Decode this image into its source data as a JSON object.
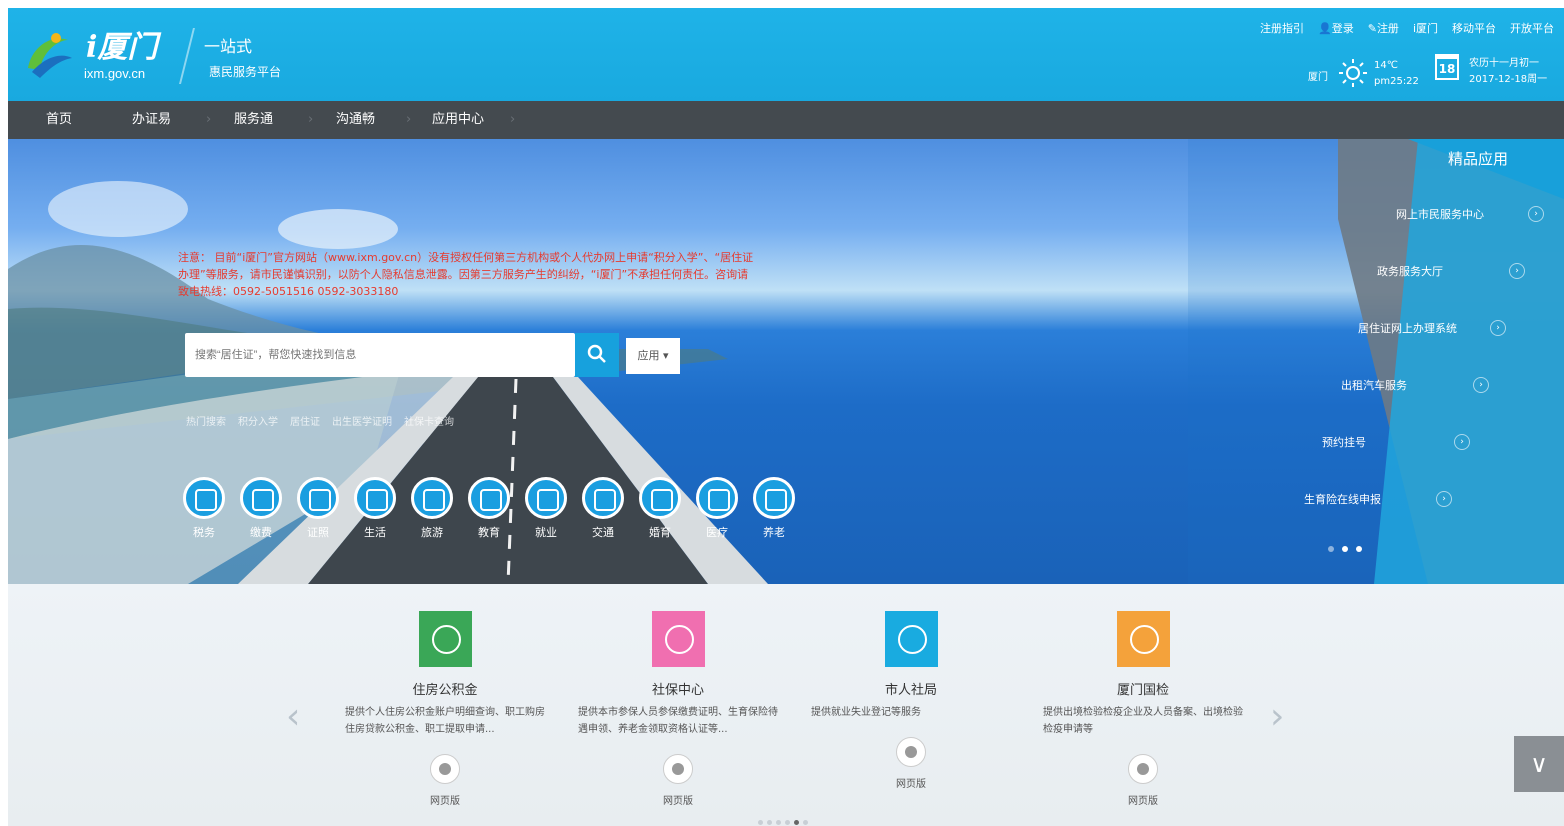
{
  "header": {
    "logo_text": "i厦门",
    "logo_url": "ixm.gov.cn",
    "slogan_line1": "一站式",
    "slogan_line2": "惠民服务平台",
    "top_links": [
      "注册指引",
      "登录",
      "注册",
      "i厦门",
      "移动平台",
      "开放平台"
    ],
    "weather_city": "厦门",
    "weather_temp": "14℃",
    "weather_pm": "pm25:22",
    "calendar_day": "18",
    "calendar_lunar": "农历十一月初一",
    "calendar_date": "2017-12-18周一"
  },
  "nav": {
    "items": [
      "首页",
      "办证易",
      "服务通",
      "沟通畅",
      "应用中心"
    ]
  },
  "banner": {
    "notice": "注意： 目前“i厦门”官方网站（www.ixm.gov.cn）没有授权任何第三方机构或个人代办网上申请“积分入学”、“居住证办理”等服务，请市民谨慎识别，以防个人隐私信息泄露。因第三方服务产生的纠纷，“i厦门”不承担任何责任。咨询请致电热线：0592-5051516 0592-3033180",
    "search_placeholder": "搜索“居住证”，帮您快速找到信息",
    "search_select": "应用",
    "hot_words": [
      "热门搜索",
      "积分入学",
      "居住证",
      "出生医学证明",
      "社保卡查询"
    ],
    "categories": [
      "税务",
      "缴费",
      "证照",
      "生活",
      "旅游",
      "教育",
      "就业",
      "交通",
      "婚育",
      "医疗",
      "养老"
    ]
  },
  "featured": {
    "title": "精品应用",
    "items": [
      "网上市民服务中心",
      "政务服务大厅",
      "居住证网上办理系统",
      "出租汽车服务",
      "预约挂号",
      "生育险在线申报"
    ]
  },
  "cards": [
    {
      "title": "住房公积金",
      "desc": "提供个人住房公积金账户明细查询、职工购房住房贷款公积金、职工提取申请...",
      "link": "网页版",
      "color": "#3aa757"
    },
    {
      "title": "社保中心",
      "desc": "提供本市参保人员参保缴费证明、生育保险待遇申领、养老金领取资格认证等...",
      "link": "网页版",
      "color": "#f06fb0"
    },
    {
      "title": "市人社局",
      "desc": "提供就业失业登记等服务",
      "link": "网页版",
      "color": "#19abe0"
    },
    {
      "title": "厦门国检",
      "desc": "提供出境检验检疫企业及人员备案、出境检验检疫申请等",
      "link": "网页版",
      "color": "#f4a23b"
    }
  ]
}
